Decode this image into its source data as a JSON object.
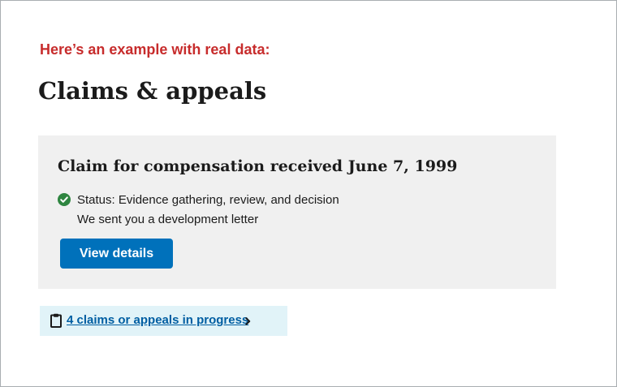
{
  "intro": {
    "text": "Here’s an example with real data:"
  },
  "page": {
    "title": "Claims & appeals"
  },
  "claim": {
    "title": "Claim for compensation received June 7, 1999",
    "status": "Status: Evidence gathering, review, and decision",
    "detail": "We sent you a development letter",
    "button_label": "View details",
    "status_icon": "check-circle-icon"
  },
  "progress": {
    "link_text": "4 claims or appeals in progress",
    "icon": "clipboard-icon",
    "chevron_icon": "chevron-right-icon"
  },
  "colors": {
    "intro_red": "#c72c2c",
    "card_background": "#f0f0f0",
    "button_blue": "#0071bb",
    "success_green": "#2e8540",
    "link_blue": "#005ea2",
    "progress_background": "#e1f3f8"
  }
}
